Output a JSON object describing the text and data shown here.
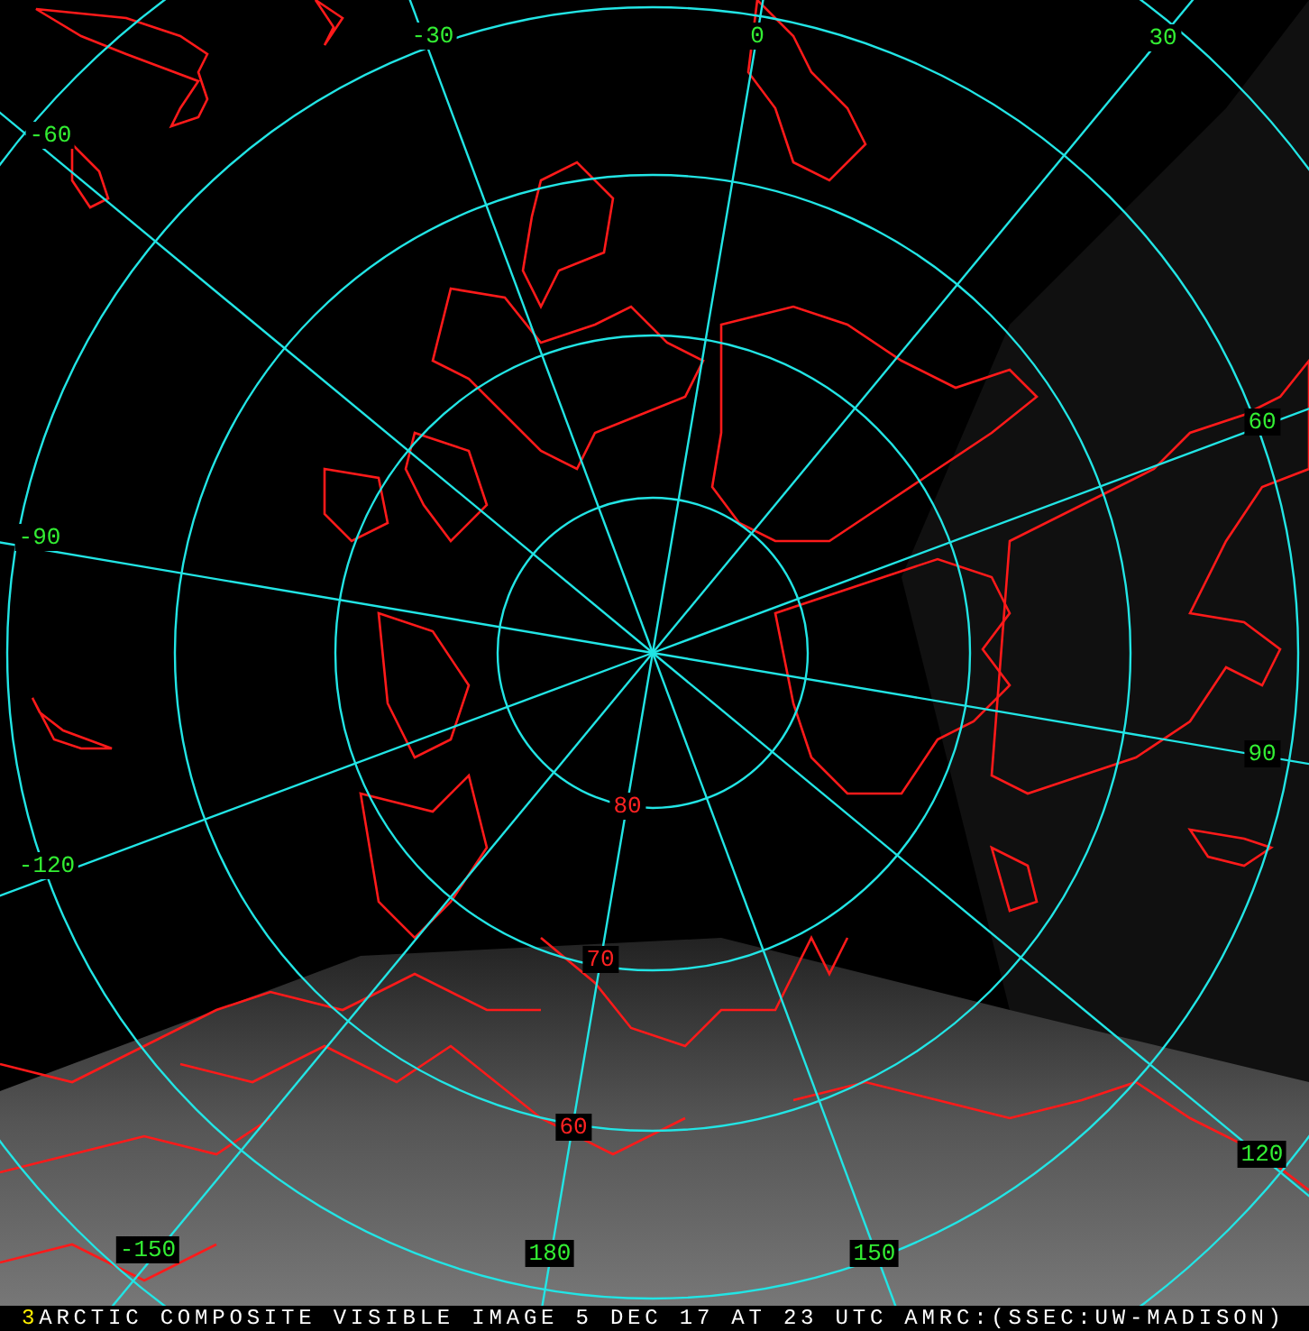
{
  "longitude_labels": [
    {
      "text": "-30"
    },
    {
      "text": "0"
    },
    {
      "text": "30"
    },
    {
      "text": "-60"
    },
    {
      "text": "60"
    },
    {
      "text": "-90"
    },
    {
      "text": "90"
    },
    {
      "text": "-120"
    },
    {
      "text": "120"
    },
    {
      "text": "-150"
    },
    {
      "text": "180"
    },
    {
      "text": "150"
    }
  ],
  "latitude_labels": [
    {
      "text": "80"
    },
    {
      "text": "70"
    },
    {
      "text": "60"
    }
  ],
  "status_bar": {
    "frame": "3",
    "caption": "ARCTIC COMPOSITE VISIBLE IMAGE 5 DEC 17 AT 23 UTC AMRC:(SSEC:UW-MADISON)"
  }
}
